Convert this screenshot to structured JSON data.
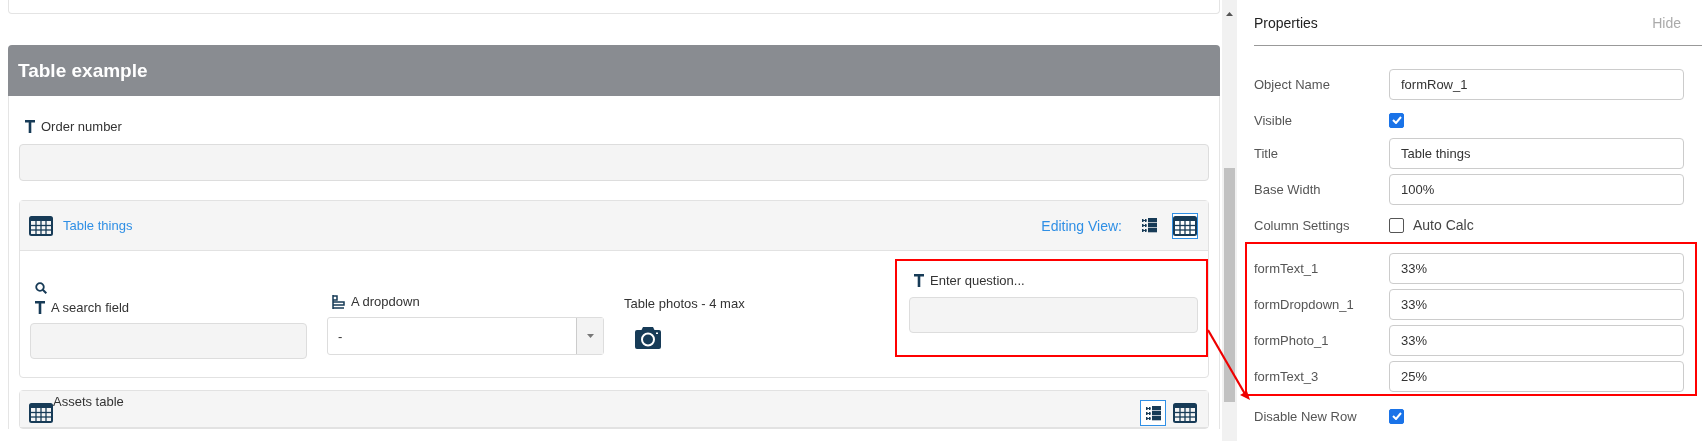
{
  "section": {
    "title": "Table example"
  },
  "order_field": {
    "label": "Order number"
  },
  "table_card": {
    "title": "Table things",
    "editing_view_label": "Editing View:",
    "views": [
      {
        "kind": "list",
        "selected": false
      },
      {
        "kind": "grid",
        "selected": true
      }
    ],
    "fields": [
      {
        "kind": "search",
        "label": "A search field"
      },
      {
        "kind": "dropdown",
        "label": "A dropdown",
        "value": "-"
      },
      {
        "kind": "photo",
        "label": "Table photos - 4 max"
      },
      {
        "kind": "text",
        "label": "Enter question...",
        "highlighted": true
      }
    ]
  },
  "assets_card": {
    "title": "Assets table",
    "views": [
      {
        "kind": "list",
        "selected": true
      },
      {
        "kind": "grid",
        "selected": false
      }
    ]
  },
  "properties": {
    "title": "Properties",
    "hide": "Hide",
    "rows": [
      {
        "kind": "input",
        "label": "Object Name",
        "value": "formRow_1"
      },
      {
        "kind": "checkbox",
        "label": "Visible",
        "checked": true
      },
      {
        "kind": "input",
        "label": "Title",
        "value": "Table things"
      },
      {
        "kind": "input",
        "label": "Base Width",
        "value": "100%"
      },
      {
        "kind": "checkbox",
        "label": "Column Settings",
        "option": "Auto Calc",
        "checked": false
      }
    ],
    "columns": [
      {
        "label": "formText_1",
        "value": "33%"
      },
      {
        "label": "formDropdown_1",
        "value": "33%"
      },
      {
        "label": "formPhoto_1",
        "value": "33%"
      },
      {
        "label": "formText_3",
        "value": "25%"
      }
    ],
    "after": [
      {
        "kind": "checkbox",
        "label": "Disable New Row",
        "checked": true
      }
    ]
  }
}
